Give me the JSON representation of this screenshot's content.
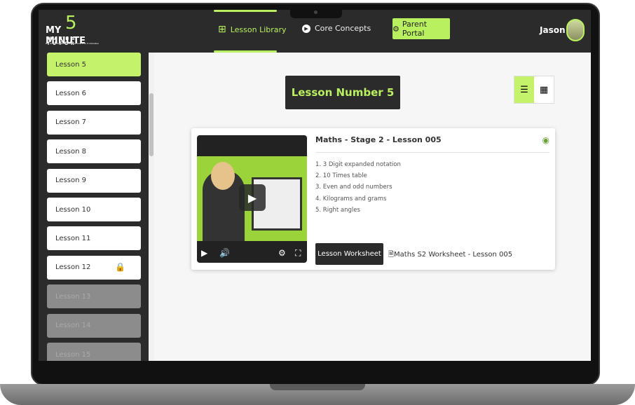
{
  "logo": {
    "line1": "MY MINUTE",
    "digit": "5",
    "line2": "MATHS TUTOR",
    "tagline": "It's amazing what you can learn in 5 minutes"
  },
  "nav": [
    {
      "label": "Lesson Library",
      "icon": "grid-icon",
      "active": true
    },
    {
      "label": "Core Concepts",
      "icon": "play-circle-icon",
      "active": false
    }
  ],
  "portal": {
    "label": "Parent Portal",
    "icon": "gear-icon"
  },
  "user": {
    "name": "Jason"
  },
  "lessons": [
    {
      "label": "Lesson 5",
      "state": "active"
    },
    {
      "label": "Lesson 6",
      "state": "available"
    },
    {
      "label": "Lesson 7",
      "state": "available"
    },
    {
      "label": "Lesson 8",
      "state": "available"
    },
    {
      "label": "Lesson 9",
      "state": "available"
    },
    {
      "label": "Lesson 10",
      "state": "available"
    },
    {
      "label": "Lesson 11",
      "state": "available"
    },
    {
      "label": "Lesson 12",
      "state": "locked"
    },
    {
      "label": "Lesson 13",
      "state": "disabled"
    },
    {
      "label": "Lesson 14",
      "state": "disabled"
    },
    {
      "label": "Lesson 15",
      "state": "disabled"
    }
  ],
  "main": {
    "title": "Lesson Number 5",
    "view": "list",
    "card": {
      "title": "Maths - Stage 2 - Lesson 005",
      "topics": [
        "1. 3 Digit expanded notation",
        "2. 10 Times table",
        "3. Even and odd numbers",
        "4. Kilograms and grams",
        "5. Right angles"
      ],
      "worksheet_button": "Lesson Worksheet",
      "worksheet_file": "Maths S2 Worksheet - Lesson 005"
    }
  },
  "colors": {
    "accent": "#b9f060",
    "dark": "#2b2b2b"
  }
}
